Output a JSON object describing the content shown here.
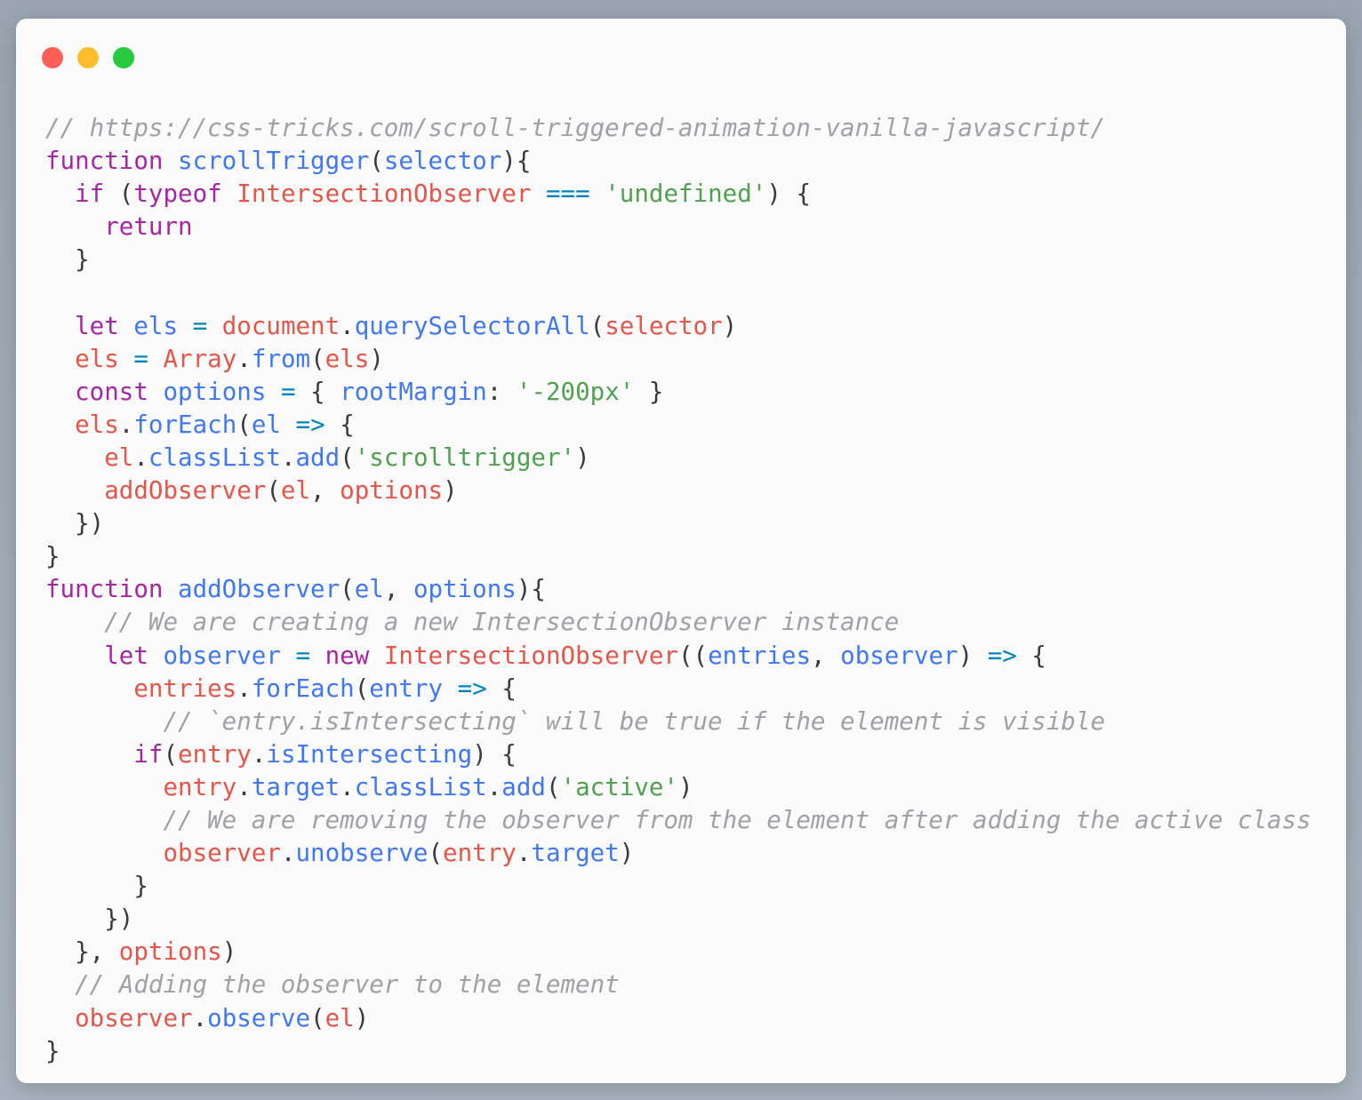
{
  "colors": {
    "window_bg": "#fafafa",
    "close": "#ff5f56",
    "minimize": "#ffbd2e",
    "maximize": "#27c93f",
    "comment": "#a0a1a7",
    "keyword": "#a626a4",
    "function": "#4078f2",
    "string": "#50a14f",
    "variable": "#e45649",
    "operator": "#0184bc",
    "plain": "#383a42"
  },
  "window_controls": [
    "close",
    "minimize",
    "maximize"
  ],
  "code": {
    "language": "javascript",
    "lines": [
      [
        [
          "comment",
          "// https://css-tricks.com/scroll-triggered-animation-vanilla-javascript/"
        ]
      ],
      [
        [
          "keyword",
          "function"
        ],
        [
          "plain",
          " "
        ],
        [
          "function",
          "scrollTrigger"
        ],
        [
          "punct",
          "("
        ],
        [
          "function",
          "selector"
        ],
        [
          "punct",
          "){"
        ]
      ],
      [
        [
          "plain",
          "  "
        ],
        [
          "keyword",
          "if"
        ],
        [
          "punct",
          " ("
        ],
        [
          "keyword",
          "typeof"
        ],
        [
          "plain",
          " "
        ],
        [
          "class",
          "IntersectionObserver"
        ],
        [
          "plain",
          " "
        ],
        [
          "operator",
          "==="
        ],
        [
          "plain",
          " "
        ],
        [
          "string",
          "'undefined'"
        ],
        [
          "punct",
          ") {"
        ]
      ],
      [
        [
          "plain",
          "    "
        ],
        [
          "keyword",
          "return"
        ]
      ],
      [
        [
          "plain",
          "  "
        ],
        [
          "punct",
          "}"
        ]
      ],
      [
        [
          "plain",
          ""
        ]
      ],
      [
        [
          "plain",
          "  "
        ],
        [
          "keyword",
          "let"
        ],
        [
          "plain",
          " "
        ],
        [
          "function",
          "els"
        ],
        [
          "plain",
          " "
        ],
        [
          "operator",
          "="
        ],
        [
          "plain",
          " "
        ],
        [
          "variable",
          "document"
        ],
        [
          "punct",
          "."
        ],
        [
          "function",
          "querySelectorAll"
        ],
        [
          "punct",
          "("
        ],
        [
          "variable",
          "selector"
        ],
        [
          "punct",
          ")"
        ]
      ],
      [
        [
          "plain",
          "  "
        ],
        [
          "variable",
          "els"
        ],
        [
          "plain",
          " "
        ],
        [
          "operator",
          "="
        ],
        [
          "plain",
          " "
        ],
        [
          "class",
          "Array"
        ],
        [
          "punct",
          "."
        ],
        [
          "function",
          "from"
        ],
        [
          "punct",
          "("
        ],
        [
          "variable",
          "els"
        ],
        [
          "punct",
          ")"
        ]
      ],
      [
        [
          "plain",
          "  "
        ],
        [
          "keyword",
          "const"
        ],
        [
          "plain",
          " "
        ],
        [
          "function",
          "options"
        ],
        [
          "plain",
          " "
        ],
        [
          "operator",
          "="
        ],
        [
          "punct",
          " { "
        ],
        [
          "function",
          "rootMargin"
        ],
        [
          "punct",
          ": "
        ],
        [
          "string",
          "'-200px'"
        ],
        [
          "punct",
          " }"
        ]
      ],
      [
        [
          "plain",
          "  "
        ],
        [
          "variable",
          "els"
        ],
        [
          "punct",
          "."
        ],
        [
          "function",
          "forEach"
        ],
        [
          "punct",
          "("
        ],
        [
          "function",
          "el"
        ],
        [
          "plain",
          " "
        ],
        [
          "operator",
          "=>"
        ],
        [
          "punct",
          " {"
        ]
      ],
      [
        [
          "plain",
          "    "
        ],
        [
          "variable",
          "el"
        ],
        [
          "punct",
          "."
        ],
        [
          "function",
          "classList"
        ],
        [
          "punct",
          "."
        ],
        [
          "function",
          "add"
        ],
        [
          "punct",
          "("
        ],
        [
          "string",
          "'scrolltrigger'"
        ],
        [
          "punct",
          ")"
        ]
      ],
      [
        [
          "plain",
          "    "
        ],
        [
          "variable",
          "addObserver"
        ],
        [
          "punct",
          "("
        ],
        [
          "variable",
          "el"
        ],
        [
          "punct",
          ", "
        ],
        [
          "variable",
          "options"
        ],
        [
          "punct",
          ")"
        ]
      ],
      [
        [
          "plain",
          "  "
        ],
        [
          "punct",
          "})"
        ]
      ],
      [
        [
          "punct",
          "}"
        ]
      ],
      [
        [
          "keyword",
          "function"
        ],
        [
          "plain",
          " "
        ],
        [
          "function",
          "addObserver"
        ],
        [
          "punct",
          "("
        ],
        [
          "function",
          "el"
        ],
        [
          "punct",
          ", "
        ],
        [
          "function",
          "options"
        ],
        [
          "punct",
          "){"
        ]
      ],
      [
        [
          "plain",
          "    "
        ],
        [
          "comment",
          "// We are creating a new IntersectionObserver instance"
        ]
      ],
      [
        [
          "plain",
          "    "
        ],
        [
          "keyword",
          "let"
        ],
        [
          "plain",
          " "
        ],
        [
          "function",
          "observer"
        ],
        [
          "plain",
          " "
        ],
        [
          "operator",
          "="
        ],
        [
          "plain",
          " "
        ],
        [
          "keyword",
          "new"
        ],
        [
          "plain",
          " "
        ],
        [
          "class",
          "IntersectionObserver"
        ],
        [
          "punct",
          "(("
        ],
        [
          "function",
          "entries"
        ],
        [
          "punct",
          ", "
        ],
        [
          "function",
          "observer"
        ],
        [
          "punct",
          ") "
        ],
        [
          "operator",
          "=>"
        ],
        [
          "punct",
          " {"
        ]
      ],
      [
        [
          "plain",
          "      "
        ],
        [
          "variable",
          "entries"
        ],
        [
          "punct",
          "."
        ],
        [
          "function",
          "forEach"
        ],
        [
          "punct",
          "("
        ],
        [
          "function",
          "entry"
        ],
        [
          "plain",
          " "
        ],
        [
          "operator",
          "=>"
        ],
        [
          "punct",
          " {"
        ]
      ],
      [
        [
          "plain",
          "        "
        ],
        [
          "comment",
          "// `entry.isIntersecting` will be true if the element is visible"
        ]
      ],
      [
        [
          "plain",
          "      "
        ],
        [
          "keyword",
          "if"
        ],
        [
          "punct",
          "("
        ],
        [
          "variable",
          "entry"
        ],
        [
          "punct",
          "."
        ],
        [
          "function",
          "isIntersecting"
        ],
        [
          "punct",
          ") {"
        ]
      ],
      [
        [
          "plain",
          "        "
        ],
        [
          "variable",
          "entry"
        ],
        [
          "punct",
          "."
        ],
        [
          "function",
          "target"
        ],
        [
          "punct",
          "."
        ],
        [
          "function",
          "classList"
        ],
        [
          "punct",
          "."
        ],
        [
          "function",
          "add"
        ],
        [
          "punct",
          "("
        ],
        [
          "string",
          "'active'"
        ],
        [
          "punct",
          ")"
        ]
      ],
      [
        [
          "plain",
          "        "
        ],
        [
          "comment",
          "// We are removing the observer from the element after adding the active class"
        ]
      ],
      [
        [
          "plain",
          "        "
        ],
        [
          "variable",
          "observer"
        ],
        [
          "punct",
          "."
        ],
        [
          "function",
          "unobserve"
        ],
        [
          "punct",
          "("
        ],
        [
          "variable",
          "entry"
        ],
        [
          "punct",
          "."
        ],
        [
          "function",
          "target"
        ],
        [
          "punct",
          ")"
        ]
      ],
      [
        [
          "plain",
          "      "
        ],
        [
          "punct",
          "}"
        ]
      ],
      [
        [
          "plain",
          "    "
        ],
        [
          "punct",
          "})"
        ]
      ],
      [
        [
          "plain",
          "  "
        ],
        [
          "punct",
          "}, "
        ],
        [
          "variable",
          "options"
        ],
        [
          "punct",
          ")"
        ]
      ],
      [
        [
          "plain",
          "  "
        ],
        [
          "comment",
          "// Adding the observer to the element"
        ]
      ],
      [
        [
          "plain",
          "  "
        ],
        [
          "variable",
          "observer"
        ],
        [
          "punct",
          "."
        ],
        [
          "function",
          "observe"
        ],
        [
          "punct",
          "("
        ],
        [
          "variable",
          "el"
        ],
        [
          "punct",
          ")"
        ]
      ],
      [
        [
          "punct",
          "}"
        ]
      ]
    ]
  }
}
